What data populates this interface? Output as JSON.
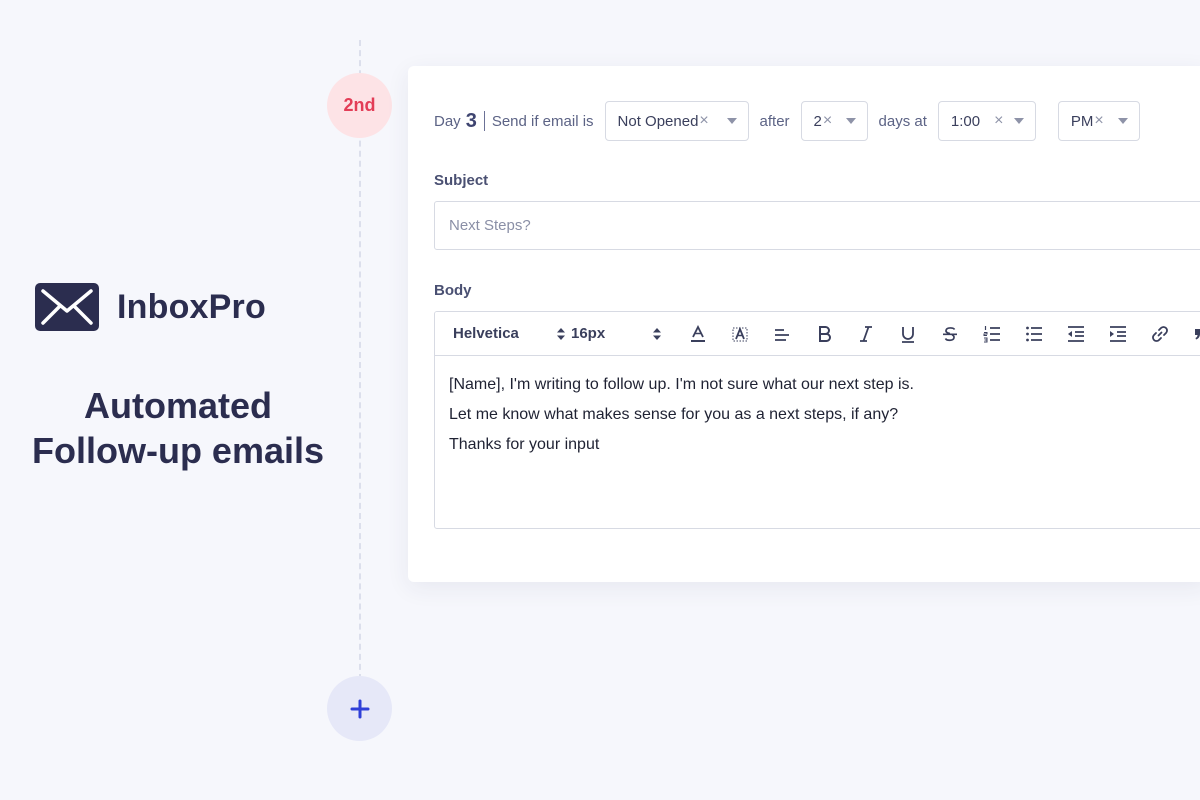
{
  "brand": {
    "name": "InboxPro",
    "tagline_line1": "Automated",
    "tagline_line2": "Follow-up emails"
  },
  "timeline": {
    "step_label": "2nd",
    "add_icon": "plus-icon"
  },
  "rule": {
    "day_label": "Day",
    "day_number": "3",
    "send_if_label": "Send if email is",
    "status_value": "Not Opened",
    "after_label": "after",
    "days_value": "2",
    "days_at_label": "days at",
    "time_value": "1:00",
    "ampm_value": "PM",
    "clear_symbol": "×"
  },
  "subject": {
    "label": "Subject",
    "placeholder": "Next Steps?"
  },
  "body": {
    "label": "Body",
    "font_family_value": "Helvetica",
    "font_size_value": "16px",
    "lines": [
      "[Name], I'm writing to follow up. I'm not sure what our next step is.",
      "Let me know what makes sense for you as a next steps, if any?",
      "Thanks for your input"
    ]
  },
  "toolbar_icons": [
    "font-color-icon",
    "highlight-icon",
    "align-left-icon",
    "bold-icon",
    "italic-icon",
    "underline-icon",
    "strikethrough-icon",
    "ordered-list-icon",
    "bullet-list-icon",
    "outdent-icon",
    "indent-icon",
    "link-icon",
    "quote-icon"
  ],
  "colors": {
    "background": "#f6f7fc",
    "brand_navy": "#2b2d4f",
    "step_badge_bg": "#fde3e6",
    "step_badge_text": "#e33d57",
    "add_button_bg": "#e6e8f8",
    "add_button_icon": "#2f3fd8"
  }
}
